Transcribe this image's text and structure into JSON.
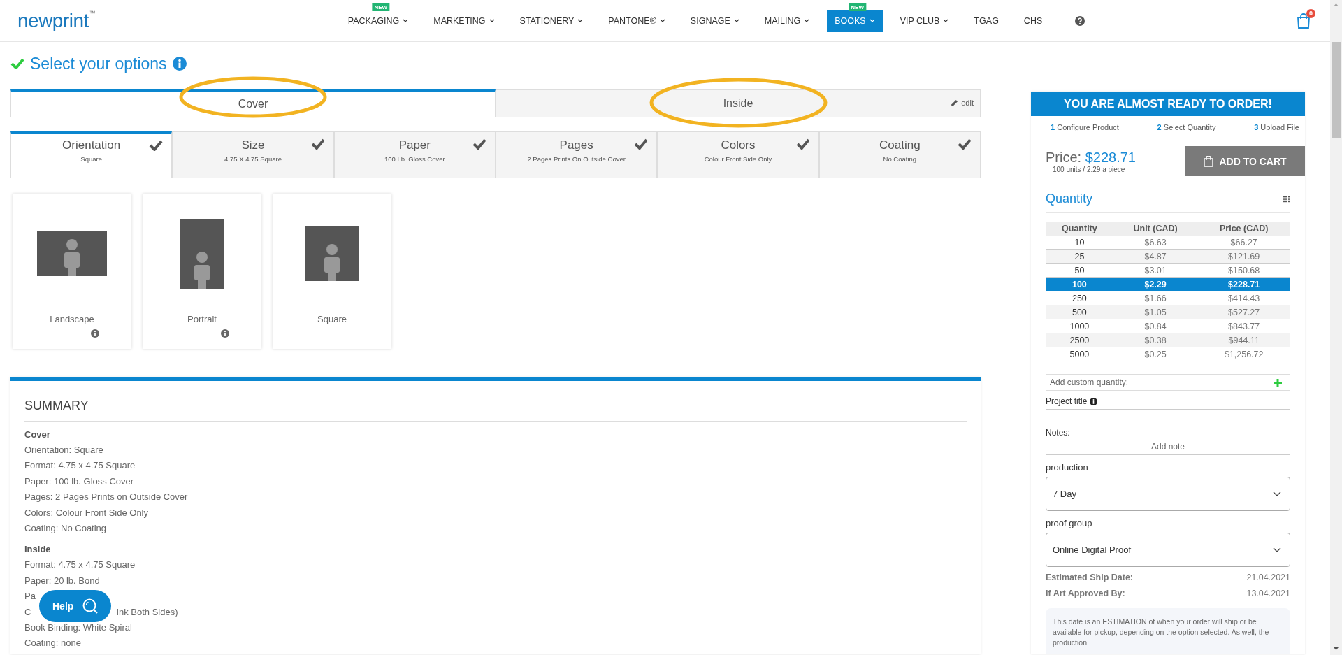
{
  "header": {
    "logo": "newprint",
    "trademark": "™",
    "cart_count": "0",
    "nav": [
      {
        "label": "PACKAGING",
        "badge": "NEW",
        "dropdown": true,
        "selected": false
      },
      {
        "label": "MARKETING",
        "dropdown": true,
        "selected": false
      },
      {
        "label": "STATIONERY",
        "dropdown": true,
        "selected": false
      },
      {
        "label": "PANTONE®",
        "dropdown": true,
        "selected": false
      },
      {
        "label": "SIGNAGE",
        "dropdown": true,
        "selected": false
      },
      {
        "label": "MAILING",
        "dropdown": true,
        "selected": false
      },
      {
        "label": "BOOKS",
        "badge": "NEW",
        "dropdown": true,
        "selected": true
      },
      {
        "label": "VIP CLUB",
        "dropdown": true,
        "selected": false
      },
      {
        "label": "TGAG",
        "dropdown": false,
        "selected": false
      },
      {
        "label": "CHS",
        "dropdown": false,
        "selected": false
      }
    ]
  },
  "page_title": "Select your options",
  "sections": [
    {
      "label": "Cover",
      "selected": true,
      "highlighted": true
    },
    {
      "label": "Inside",
      "selected": false,
      "highlighted": true
    }
  ],
  "edit_link": "edit",
  "option_tabs": [
    {
      "title": "Orientation",
      "value": "Square",
      "selected": true,
      "done": true
    },
    {
      "title": "Size",
      "value": "4.75 X 4.75 Square",
      "selected": false,
      "done": true
    },
    {
      "title": "Paper",
      "value": "100 Lb. Gloss Cover",
      "selected": false,
      "done": true
    },
    {
      "title": "Pages",
      "value": "2 Pages Prints On Outside Cover",
      "selected": false,
      "done": true
    },
    {
      "title": "Colors",
      "value": "Colour Front Side Only",
      "selected": false,
      "done": true
    },
    {
      "title": "Coating",
      "value": "No Coating",
      "selected": false,
      "done": true
    }
  ],
  "choices": [
    {
      "label": "Landscape",
      "kind": "landscape",
      "info": true
    },
    {
      "label": "Portrait",
      "kind": "portrait",
      "info": true
    },
    {
      "label": "Square",
      "kind": "square",
      "info": false
    }
  ],
  "summary": {
    "title": "SUMMARY",
    "groups": [
      {
        "heading": "Cover",
        "lines": [
          [
            "Orientation: Square"
          ],
          [
            "Format: 4.75 x 4.75 Square"
          ],
          [
            "Paper: 100 lb. Gloss Cover"
          ],
          [
            "Pages: 2 Pages Prints on Outside Cover"
          ],
          [
            "Colors: Colour Front Side Only"
          ],
          [
            "Coating: No Coating"
          ]
        ]
      },
      {
        "heading": "Inside",
        "lines": [
          [
            "Format: 4.75 x 4.75 Square"
          ],
          [
            "Paper: 20 lb. Bond"
          ],
          [
            "Pa"
          ],
          [
            "C",
            "Ink Both Sides)"
          ],
          [
            "Book Binding: White Spiral"
          ],
          [
            "Coating: none"
          ]
        ]
      }
    ]
  },
  "help_button": "Help",
  "order": {
    "banner": "YOU ARE ALMOST READY TO ORDER!",
    "steps": [
      {
        "number": "1",
        "label": "Configure Product"
      },
      {
        "number": "2",
        "label": "Select Quantity"
      },
      {
        "number": "3",
        "label": "Upload File"
      }
    ],
    "price_label": "Price:",
    "price": "$228.71",
    "price_note": "100 units / 2.29 a piece",
    "add_to_cart": "ADD TO CART",
    "quantity_title": "Quantity",
    "columns": [
      "Quantity",
      "Unit (CAD)",
      "Price (CAD)"
    ],
    "rows": [
      {
        "cells": [
          "10",
          "$6.63",
          "$66.27"
        ],
        "selected": false
      },
      {
        "cells": [
          "25",
          "$4.87",
          "$121.69"
        ],
        "selected": false
      },
      {
        "cells": [
          "50",
          "$3.01",
          "$150.68"
        ],
        "selected": false
      },
      {
        "cells": [
          "100",
          "$2.29",
          "$228.71"
        ],
        "selected": true
      },
      {
        "cells": [
          "250",
          "$1.66",
          "$414.43"
        ],
        "selected": false
      },
      {
        "cells": [
          "500",
          "$1.05",
          "$527.27"
        ],
        "selected": false
      },
      {
        "cells": [
          "1000",
          "$0.84",
          "$843.77"
        ],
        "selected": false
      },
      {
        "cells": [
          "2500",
          "$0.38",
          "$944.11"
        ],
        "selected": false
      },
      {
        "cells": [
          "5000",
          "$0.25",
          "$1,256.72"
        ],
        "selected": false
      }
    ],
    "custom_quantity": {
      "placeholder": "Add custom quantity:"
    },
    "project_title_label": "Project title",
    "notes_label": "Notes:",
    "add_note": "Add note",
    "selects": [
      {
        "label": "production",
        "value": "7 Day"
      },
      {
        "label": "proof group",
        "value": "Online Digital Proof"
      }
    ],
    "dates": [
      {
        "label": "Estimated Ship Date:",
        "value": "21.04.2021"
      },
      {
        "label": "If Art Approved By:",
        "value": "13.04.2021"
      }
    ],
    "disclaimer": "This date is an ESTIMATION of when your order will ship or be available for pickup, depending on the option selected. As well, the production"
  }
}
